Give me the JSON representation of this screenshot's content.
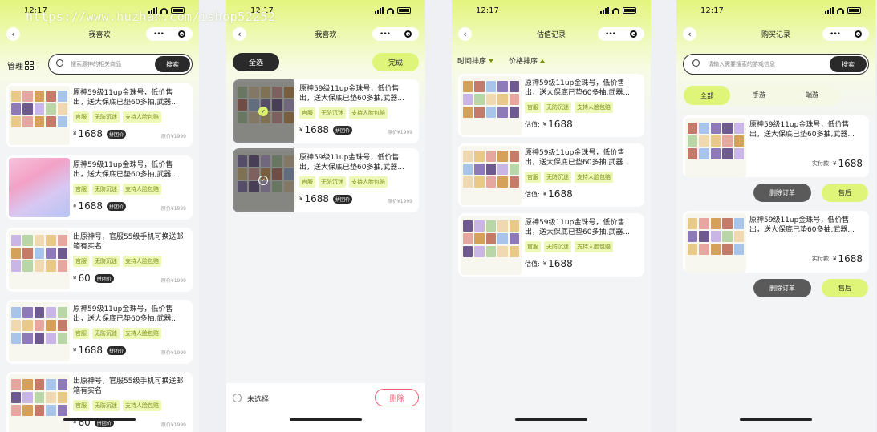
{
  "watermark": "https://www.huzhan.com/ishop52252",
  "status": {
    "time": "12:17"
  },
  "colors": {
    "accent": "#dff57a",
    "dark": "#2a2a2a",
    "tag_bg": "#eef9b9",
    "tag_fg": "#7a8f10",
    "delete_red": "#f05a6a"
  },
  "s1": {
    "title": "我喜欢",
    "manage_label": "管理",
    "search_placeholder": "搜索原神的相关商品",
    "search_button": "搜索",
    "items": [
      {
        "title": "原神59级11up金珠号，低价售出，送大保底已垫60多抽,武器...",
        "tags": [
          "官服",
          "无防沉迷",
          "支持人脸包赔"
        ],
        "yen": "¥",
        "price": "1688",
        "badge": "拼团价",
        "orig": "原价¥1999"
      },
      {
        "title": "原神59级11up金珠号，低价售出，送大保底已垫60多抽,武器...",
        "tags": [
          "官服",
          "无防沉迷",
          "支持人脸包赔"
        ],
        "yen": "¥",
        "price": "1688",
        "badge": "拼团价",
        "orig": "原价¥1999"
      },
      {
        "title": "出原神号，官服55级手机可换送邮箱有实名",
        "tags": [
          "官服",
          "无防沉迷",
          "支持人脸包赔"
        ],
        "yen": "¥",
        "price": "60",
        "badge": "拼团价",
        "orig": "原价¥1999"
      },
      {
        "title": "原神59级11up金珠号，低价售出，送大保底已垫60多抽,武器...",
        "tags": [
          "官服",
          "无防沉迷",
          "支持人脸包赔"
        ],
        "yen": "¥",
        "price": "1688",
        "badge": "拼团价",
        "orig": "原价¥1999"
      },
      {
        "title": "出原神号，官服55级手机可换送邮箱有实名",
        "tags": [
          "官服",
          "无防沉迷",
          "支持人脸包赔"
        ],
        "yen": "¥",
        "price": "60",
        "badge": "拼团价",
        "orig": "原价¥1999"
      }
    ]
  },
  "s2": {
    "title": "我喜欢",
    "select_all": "全选",
    "done": "完成",
    "unselected": "未选择",
    "delete": "删除",
    "items": [
      {
        "title": "原神59级11up金珠号，低价售出，送大保底已垫60多抽,武器...",
        "tags": [
          "官服",
          "无防沉迷",
          "支持人脸包赔"
        ],
        "yen": "¥",
        "price": "1688",
        "badge": "拼团价",
        "orig": "原价¥1999"
      },
      {
        "title": "原神59级11up金珠号，低价售出，送大保底已垫60多抽,武器...",
        "tags": [
          "官服",
          "无防沉迷",
          "支持人脸包赔"
        ],
        "yen": "¥",
        "price": "1688",
        "badge": "拼团价",
        "orig": "原价¥1999"
      }
    ]
  },
  "s3": {
    "title": "估值记录",
    "sort_time": "时间排序",
    "sort_price": "价格排序",
    "items": [
      {
        "title": "原神59级11up金珠号，低价售出，送大保底已垫60多抽,武器...",
        "tags": [
          "官服",
          "无防沉迷",
          "支持人脸包赔"
        ],
        "val_label": "估值:",
        "yen": "¥",
        "price": "1688"
      },
      {
        "title": "原神59级11up金珠号，低价售出，送大保底已垫60多抽,武器...",
        "tags": [
          "官服",
          "无防沉迷",
          "支持人脸包赔"
        ],
        "val_label": "估值:",
        "yen": "¥",
        "price": "1688"
      },
      {
        "title": "原神59级11up金珠号，低价售出，送大保底已垫60多抽,武器...",
        "tags": [
          "官服",
          "无防沉迷",
          "支持人脸包赔"
        ],
        "val_label": "估值:",
        "yen": "¥",
        "price": "1688"
      }
    ]
  },
  "s4": {
    "title": "购买记录",
    "search_placeholder": "请输入需要搜索的游戏信息",
    "search_button": "搜索",
    "tabs": [
      "全部",
      "手游",
      "端游"
    ],
    "items": [
      {
        "title": "原神59级11up金珠号，低价售出，送大保底已垫60多抽,武器...",
        "paid_label": "实付款",
        "yen": "¥",
        "price": "1688",
        "delete_order": "删除订单",
        "after_sale": "售后"
      },
      {
        "title": "原神59级11up金珠号，低价售出，送大保底已垫60多抽,武器...",
        "paid_label": "实付款",
        "yen": "¥",
        "price": "1688",
        "delete_order": "删除订单",
        "after_sale": "售后"
      }
    ]
  }
}
